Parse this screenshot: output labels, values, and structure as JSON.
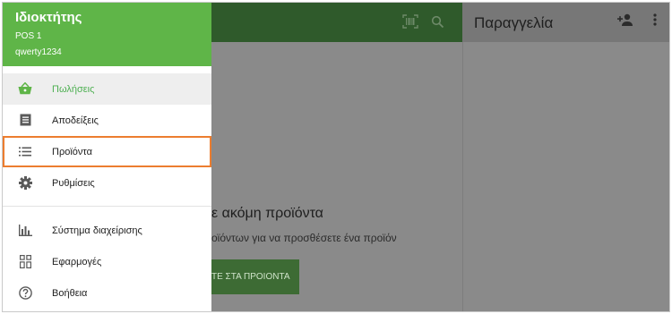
{
  "drawer": {
    "owner": "Ιδιοκτήτης",
    "pos": "POS 1",
    "user": "qwerty1234",
    "items": [
      {
        "label": "Πωλήσεις",
        "icon": "basket-icon"
      },
      {
        "label": "Αποδείξεις",
        "icon": "receipt-icon"
      },
      {
        "label": "Προϊόντα",
        "icon": "list-icon"
      },
      {
        "label": "Ρυθμίσεις",
        "icon": "gear-icon"
      }
    ],
    "items2": [
      {
        "label": "Σύστημα διαχείρισης",
        "icon": "bar-chart-icon"
      },
      {
        "label": "Εφαρμογές",
        "icon": "apps-icon"
      },
      {
        "label": "Βοήθεια",
        "icon": "help-icon"
      }
    ]
  },
  "main": {
    "empty_title": "ε ακόμη προϊόντα",
    "empty_subtitle": "οϊόντων για να προσθέσετε ένα προϊόν",
    "empty_button": "ΤΕ ΣΤΑ ΠΡΟΙΟΝΤΑ"
  },
  "order": {
    "title": "Παραγγελία"
  },
  "colors": {
    "accent": "#5fb548",
    "highlight": "#ec7d2f"
  }
}
